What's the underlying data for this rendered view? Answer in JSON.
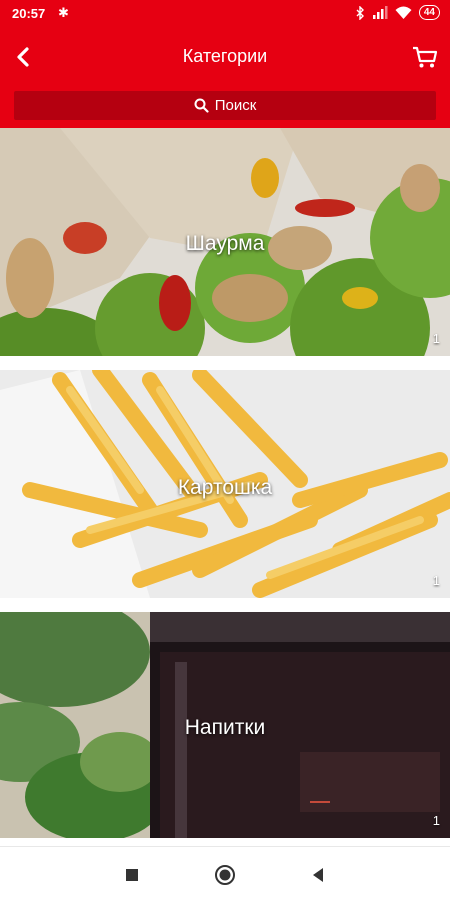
{
  "status_bar": {
    "time": "20:57",
    "battery": "44"
  },
  "header": {
    "title": "Категории"
  },
  "search": {
    "label": "Поиск"
  },
  "categories": [
    {
      "name": "Шаурма",
      "count": "1"
    },
    {
      "name": "Картошка",
      "count": "1"
    },
    {
      "name": "Напитки",
      "count": "1"
    }
  ],
  "colors": {
    "primary": "#e60012",
    "search_bg": "#b50010"
  }
}
